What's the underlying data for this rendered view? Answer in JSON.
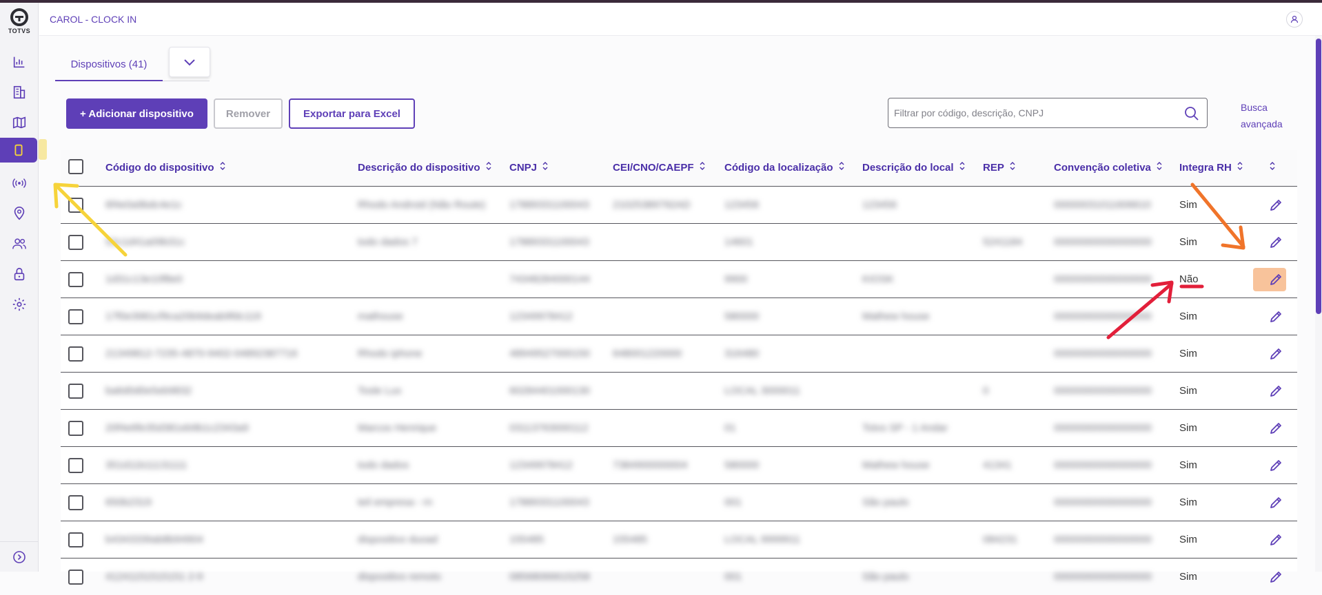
{
  "app": {
    "logo_text": "TOTVS",
    "title": "CAROL - CLOCK IN"
  },
  "sidebar": {
    "items": [
      {
        "icon": "chart-icon"
      },
      {
        "icon": "building-icon"
      },
      {
        "icon": "map-icon"
      },
      {
        "icon": "device-icon",
        "active": true
      },
      {
        "icon": "broadcast-icon"
      },
      {
        "icon": "location-pin-icon"
      },
      {
        "icon": "users-icon"
      },
      {
        "icon": "lock-icon"
      },
      {
        "icon": "gear-icon"
      }
    ],
    "expand_icon": "chevron-right-circle-icon"
  },
  "tabs": {
    "active_label": "Dispositivos (41)",
    "more_icon": "chevron-down-icon"
  },
  "toolbar": {
    "add_label": "+ Adicionar dispositivo",
    "remove_label": "Remover",
    "export_label": "Exportar para Excel",
    "search_placeholder": "Filtrar por código, descrição, CNPJ",
    "advanced_label": "Busca avançada"
  },
  "table": {
    "columns": [
      "Código do dispositivo",
      "Descrição do dispositivo",
      "CNPJ",
      "CEI/CNO/CAEPF",
      "Código da localização",
      "Descrição do local",
      "REP",
      "Convenção coletiva",
      "Integra RH"
    ],
    "rows": [
      {
        "codigo": "6f4e0a9bdc4e1c",
        "descricao": "Rhodo Android (Não Route)",
        "cnpj": "17889331100043",
        "cei": "21025389792AD",
        "cod_local": "123456",
        "desc_local": "123456",
        "rep": "",
        "convencao": "00000031011606610",
        "integra": "Sim"
      },
      {
        "codigo": "52c1d41a09b31c",
        "descricao": "todo dados 7",
        "cnpj": "17889331100043",
        "cei": "",
        "cod_local": "14601",
        "desc_local": "",
        "rep": "5241184",
        "convencao": "00000000000000000",
        "integra": "Sim"
      },
      {
        "codigo": "1d31c13e10f8e0",
        "descricao": "",
        "cnpj": "74348284000144",
        "cei": "",
        "cod_local": "9900",
        "desc_local": "KIOSK",
        "rep": "",
        "convencao": "00000000000000000",
        "integra": "Não"
      },
      {
        "codigo": "17f0e3981cf9ca20b9deab9fdc119",
        "descricao": "mathouse",
        "cnpj": "12349978412",
        "cei": "",
        "cod_local": "580000",
        "desc_local": "Mathew house",
        "rep": "",
        "convencao": "00000000000000000",
        "integra": "Sim"
      },
      {
        "codigo": "21349812-7235-4870-9402-04892387716",
        "descricao": "Rhodo iphone",
        "cnpj": "48949527000150",
        "cei": "648001220000",
        "cod_local": "316480",
        "desc_local": "",
        "rep": "",
        "convencao": "00000000000000000",
        "integra": "Sim"
      },
      {
        "codigo": "ba6d0d0e5eb9832",
        "descricao": "Tosle Lux",
        "cnpj": "60284401000130",
        "cei": "",
        "cod_local": "LOCAL 3000011",
        "desc_local": "",
        "rep": "0",
        "convencao": "00000000000000000",
        "integra": "Sim"
      },
      {
        "codigo": "20f4e6fe35d381eb9b1c2343a9",
        "descricao": "Marcos Henrique",
        "cnpj": "03113763000112",
        "cei": "",
        "cod_local": "01",
        "desc_local": "Totvs SP - 1 Andar",
        "rep": "",
        "convencao": "00000000000000000",
        "integra": "Sim"
      },
      {
        "codigo": "351d11b11131111",
        "descricao": "todo dados",
        "cnpj": "12349978412",
        "cei": "7384900000004",
        "cod_local": "580000",
        "desc_local": "Mathew house",
        "rep": "41341",
        "convencao": "00000000000000000",
        "integra": "Sim"
      },
      {
        "codigo": "650b2319",
        "descricao": "teil empresa - rn",
        "cnpj": "17889331100043",
        "cei": "",
        "cod_local": "001",
        "desc_local": "São paulo",
        "rep": "",
        "convencao": "00000000000000000",
        "integra": "Sim"
      },
      {
        "codigo": "b4343339ab8b94904",
        "descricao": "dispositivo duoad",
        "cnpj": "155485",
        "cei": "155485",
        "cod_local": "LOCAL 9999911",
        "desc_local": "",
        "rep": "084231",
        "convencao": "00000000000000000",
        "integra": "Sim"
      },
      {
        "codigo": "41241151515151 2-9",
        "descricao": "dispositivo remoto",
        "cnpj": "08568066615258",
        "cei": "",
        "cod_local": "001",
        "desc_local": "São paulo",
        "rep": "",
        "convencao": "00000000000000000",
        "integra": "Sim"
      }
    ]
  },
  "colors": {
    "accent": "#5e3fb7",
    "highlight_yellow": "#f6d33a",
    "arrow_orange": "#f0742a",
    "arrow_red": "#e21f3a"
  }
}
